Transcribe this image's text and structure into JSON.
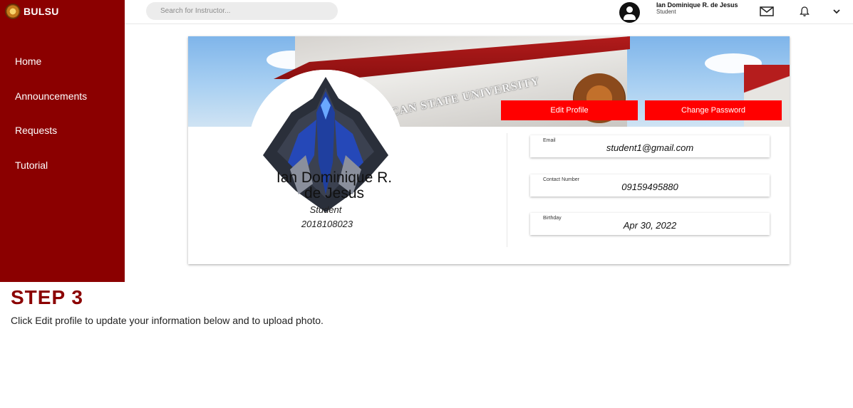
{
  "brand": {
    "name": "BULSU"
  },
  "sidebar": {
    "items": [
      {
        "label": "Home"
      },
      {
        "label": "Announcements"
      },
      {
        "label": "Requests"
      },
      {
        "label": "Tutorial"
      }
    ]
  },
  "topbar": {
    "search_placeholder": "Search for Instructor...",
    "user_name": "Ian Dominique R. de Jesus",
    "user_role": "Student",
    "icons": [
      "mail-icon",
      "bell-icon",
      "chevron-down-icon"
    ]
  },
  "banner": {
    "text": "ACAN STATE UNIVERSITY"
  },
  "profile": {
    "name_line1": "Ian Dominique R.",
    "name_line2": "de Jesus",
    "role": "Student",
    "student_id": "2018108023",
    "edit_button": "Edit Profile",
    "change_password_button": "Change Password"
  },
  "details": {
    "email_label": "Email",
    "email_value": "student1@gmail.com",
    "contact_label": "Contact Number",
    "contact_value": "09159495880",
    "birthday_label": "Birthday",
    "birthday_value": "Apr 30, 2022"
  },
  "tutorial": {
    "step_title": "STEP 3",
    "step_text": "Click Edit profile to update your information below and to upload photo."
  },
  "colors": {
    "sidebar": "#8b0000",
    "button": "#ff0000",
    "step_title": "#8b0000"
  }
}
